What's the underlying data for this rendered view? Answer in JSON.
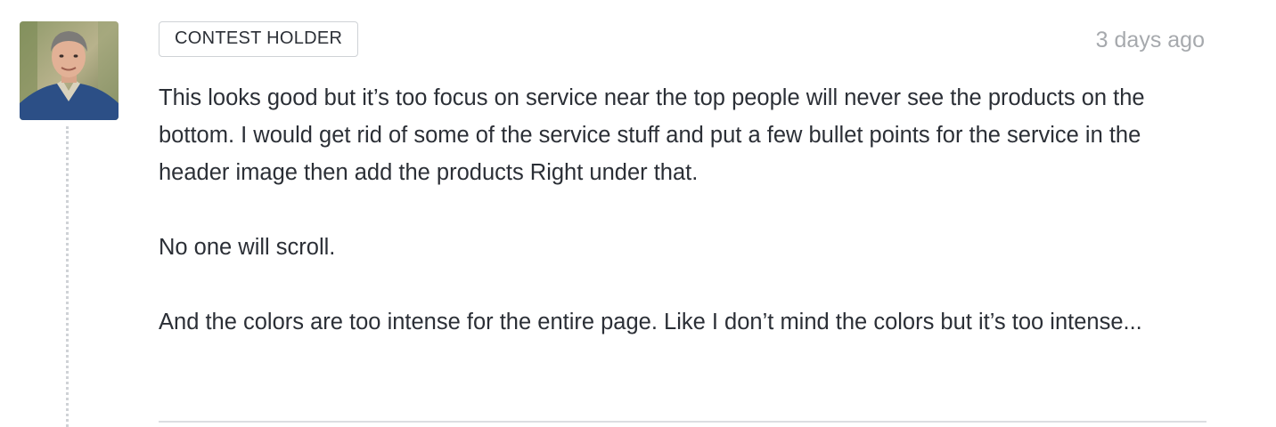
{
  "comment": {
    "badge": "CONTEST HOLDER",
    "timestamp": "3 days ago",
    "paragraphs": [
      "This looks good but it’s too focus on service near the top people will never see the products on the bottom. I would get rid of some of the service stuff and put a few bullet points for the service in the header image then add the products Right under that.",
      "No one will scroll.",
      "And the colors are too intense for the entire page. Like I don’t mind the colors but it’s too intense..."
    ]
  },
  "colors": {
    "text": "#2b2f36",
    "muted": "#a6a9ad",
    "border": "#cfd2d6"
  }
}
